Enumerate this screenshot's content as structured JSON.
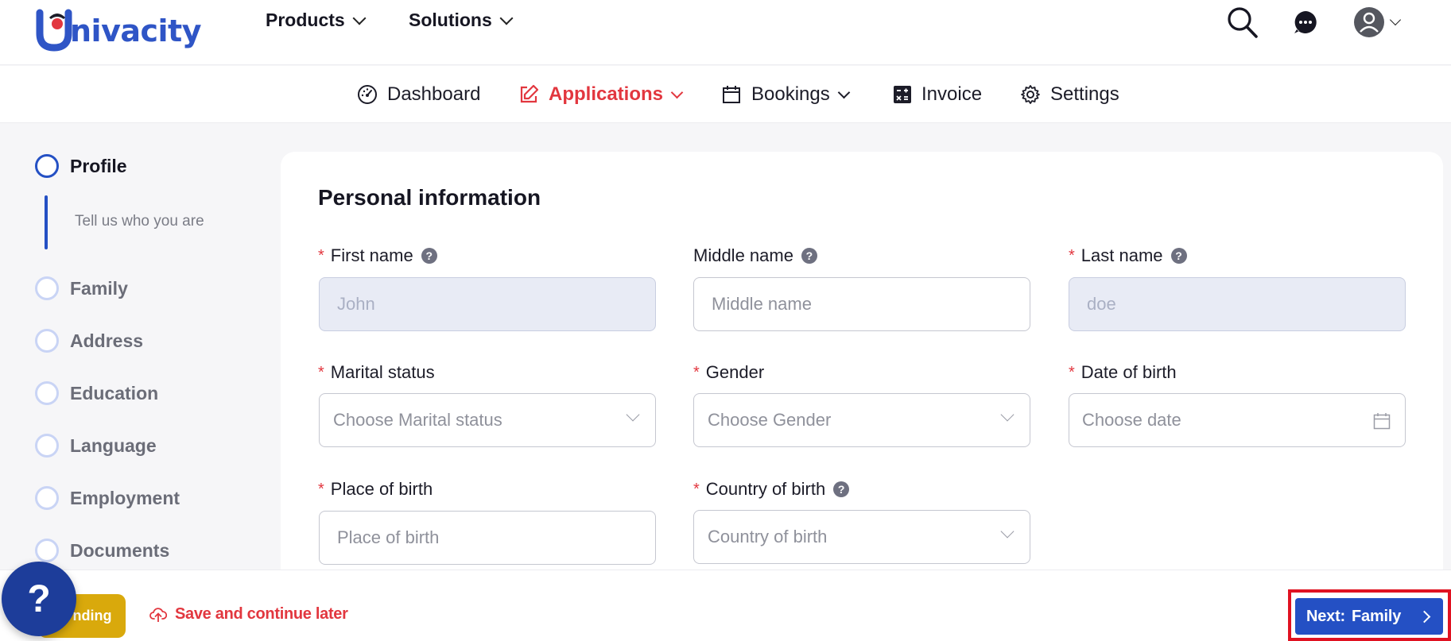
{
  "brand": {
    "name": "nivacity",
    "initial": "U"
  },
  "top_menu": [
    {
      "label": "Products"
    },
    {
      "label": "Solutions"
    }
  ],
  "nav": [
    {
      "label": "Dashboard",
      "icon": "gauge-icon"
    },
    {
      "label": "Applications",
      "icon": "edit-icon",
      "active": true
    },
    {
      "label": "Bookings",
      "icon": "calendar-icon"
    },
    {
      "label": "Invoice",
      "icon": "calculator-icon"
    },
    {
      "label": "Settings",
      "icon": "gear-icon"
    }
  ],
  "steps": [
    {
      "label": "Profile",
      "description": "Tell us who you are",
      "active": true
    },
    {
      "label": "Family"
    },
    {
      "label": "Address"
    },
    {
      "label": "Education"
    },
    {
      "label": "Language"
    },
    {
      "label": "Employment"
    },
    {
      "label": "Documents"
    }
  ],
  "form": {
    "title": "Personal information",
    "first_name": {
      "label": "First name",
      "placeholder": "John"
    },
    "middle_name": {
      "label": "Middle name",
      "placeholder": "Middle name"
    },
    "last_name": {
      "label": "Last name",
      "placeholder": "doe"
    },
    "marital_status": {
      "label": "Marital status",
      "placeholder": "Choose Marital status"
    },
    "gender": {
      "label": "Gender",
      "placeholder": "Choose Gender"
    },
    "date_of_birth": {
      "label": "Date of birth",
      "placeholder": "Choose date"
    },
    "place_of_birth": {
      "label": "Place of birth",
      "placeholder": "Place of birth"
    },
    "country_of_birth": {
      "label": "Country of birth",
      "placeholder": "Country of birth"
    },
    "required_mark": "*",
    "help_mark": "?"
  },
  "footer": {
    "status_label": "nding",
    "help_fab": "?",
    "save_later": "Save and continue later",
    "next_prefix": "Next:",
    "next_step": "Family"
  },
  "colors": {
    "brand_blue": "#2f55c6",
    "accent_red": "#e2373f",
    "primary_button": "#2450c4",
    "pending_badge": "#d9a90c",
    "highlight_border": "#e01221"
  }
}
